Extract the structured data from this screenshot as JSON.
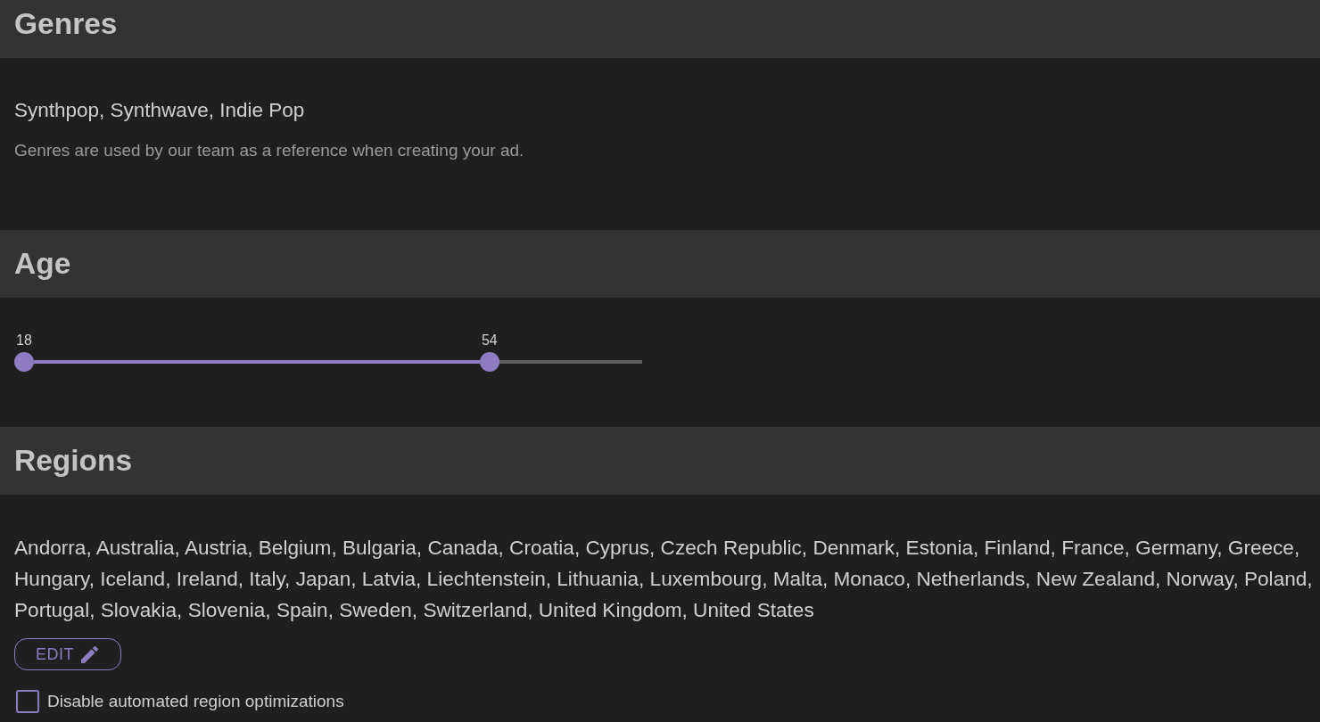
{
  "sections": [
    {
      "kind": "text",
      "title": "Genres",
      "value": "Synthpop, Synthwave, Indie Pop",
      "hint": "Genres are used by our team as a reference when creating your ad."
    },
    {
      "kind": "range",
      "title": "Age",
      "thumbs": [
        {
          "label": "18",
          "level": 0
        },
        {
          "label": "54",
          "level": 0.753
        }
      ]
    },
    {
      "kind": "list",
      "title": "Regions",
      "value": "Andorra, Australia, Austria, Belgium, Bulgaria, Canada, Croatia, Cyprus, Czech Republic, Denmark, Estonia, Finland, France, Germany, Greece, Hungary, Iceland, Ireland, Italy, Japan, Latvia, Liechtenstein, Lithuania, Luxembourg, Malta, Monaco, Netherlands, New Zealand, Norway, Poland, Portugal, Slovakia, Slovenia, Spain, Sweden, Switzerland, United Kingdom, United States",
      "edit_button": "EDIT",
      "checkbox": {
        "label": "Disable automated region optimizations",
        "checked": false
      }
    }
  ]
}
